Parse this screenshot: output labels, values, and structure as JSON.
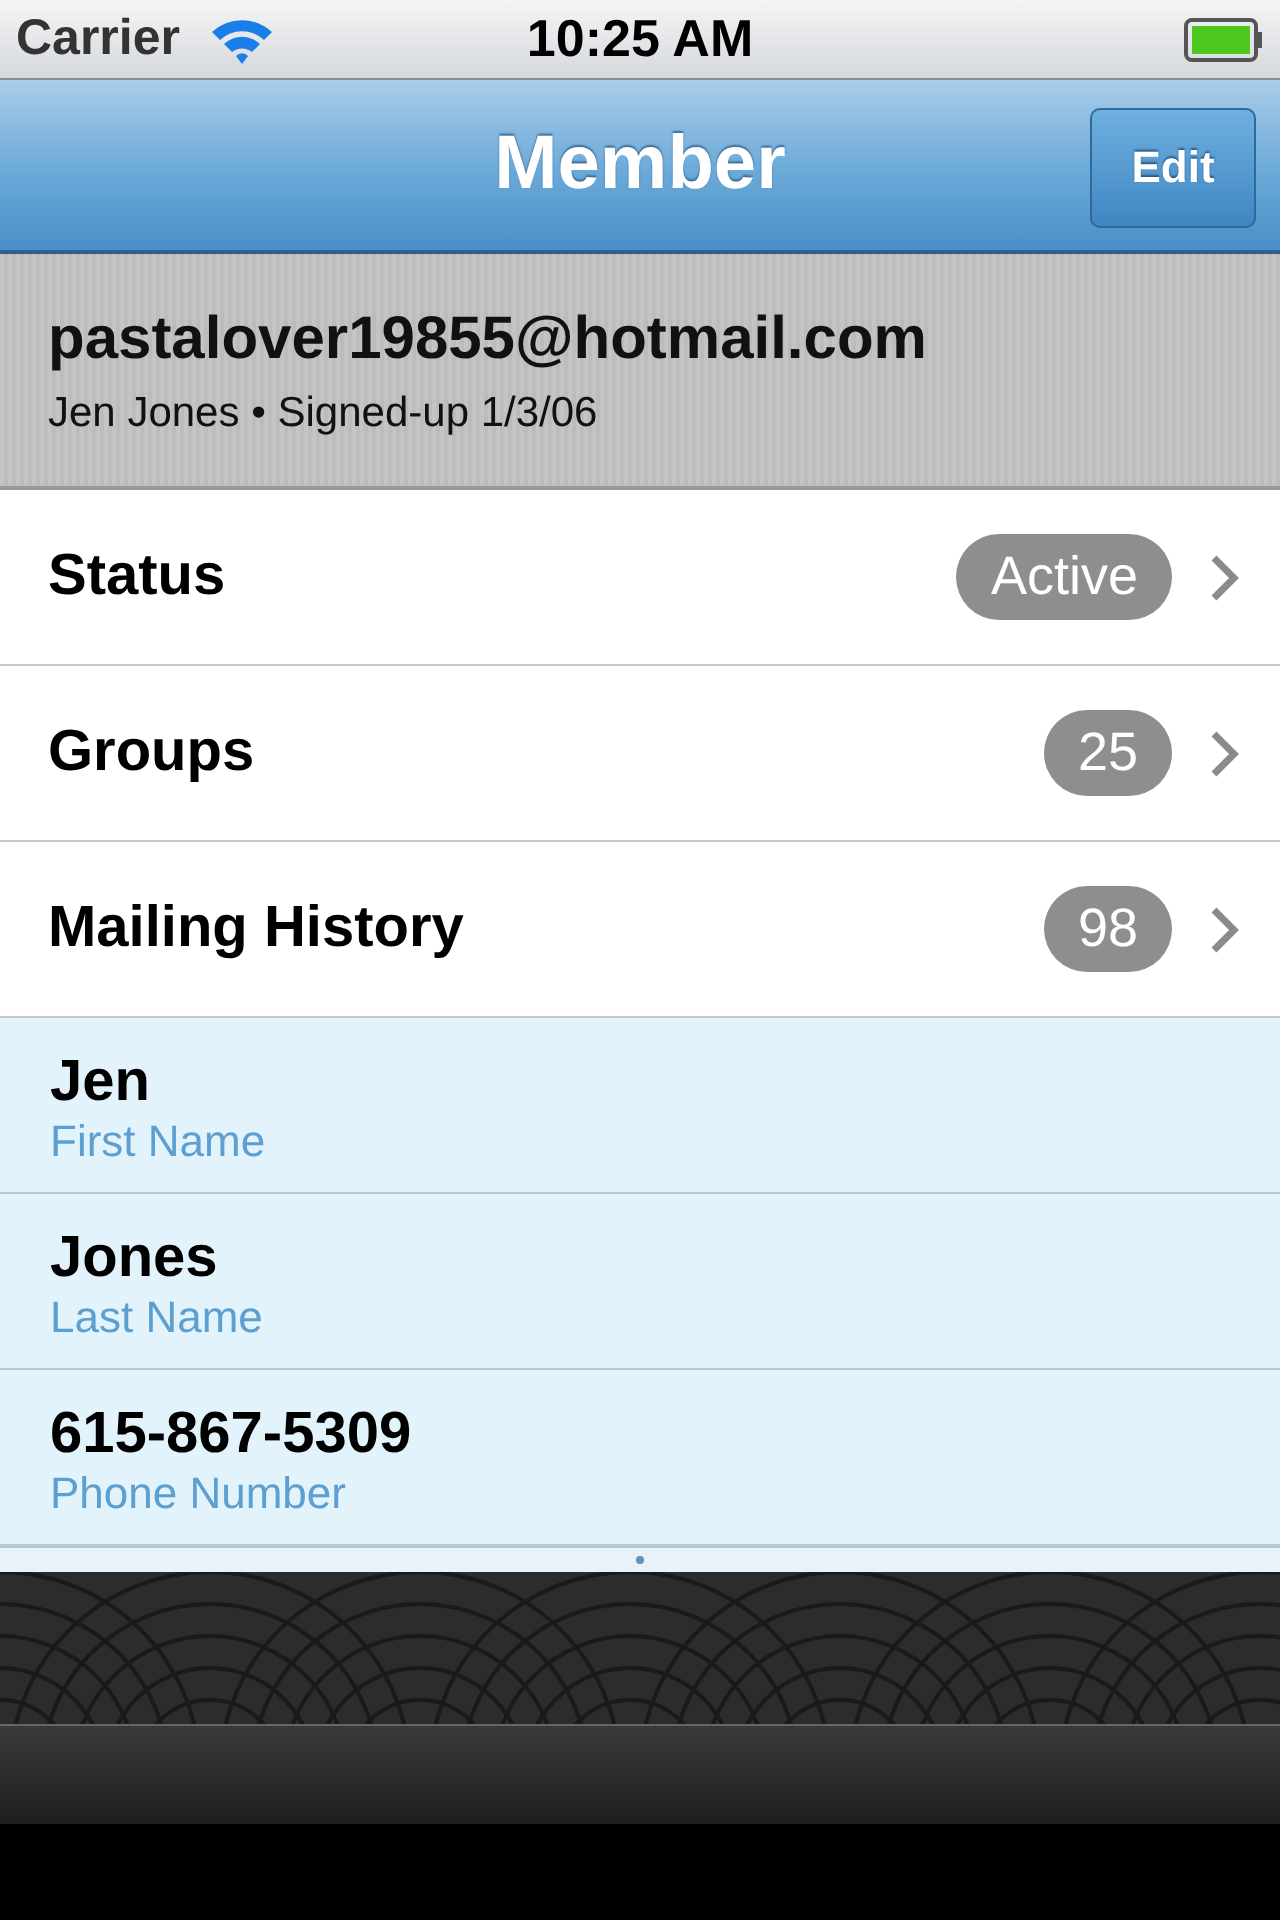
{
  "status_bar": {
    "carrier": "Carrier",
    "time": "10:25 AM"
  },
  "nav_bar": {
    "title": "Member",
    "edit_button": "Edit"
  },
  "header": {
    "email": "pastalover19855@hotmail.com",
    "subtitle": "Jen Jones • Signed-up 1/3/06"
  },
  "menu": [
    {
      "label": "Status",
      "badge": "Active"
    },
    {
      "label": "Groups",
      "badge": "25"
    },
    {
      "label": "Mailing History",
      "badge": "98"
    }
  ],
  "fields": [
    {
      "value": "Jen",
      "label": "First Name"
    },
    {
      "value": "Jones",
      "label": "Last Name"
    },
    {
      "value": "615-867-5309",
      "label": "Phone Number"
    }
  ]
}
